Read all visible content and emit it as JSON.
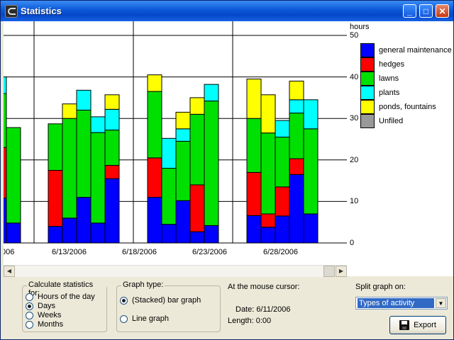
{
  "window": {
    "title": "Statistics"
  },
  "titlebar": {
    "minimize": "_",
    "maximize": "□",
    "close": "✕"
  },
  "axis": {
    "unit": "hours",
    "ticks": [
      "50",
      "40",
      "30",
      "20",
      "10",
      "0"
    ]
  },
  "legend": [
    {
      "label": "general maintenance",
      "color": "#0000ff"
    },
    {
      "label": "hedges",
      "color": "#ff0000"
    },
    {
      "label": "lawns",
      "color": "#00e000"
    },
    {
      "label": "plants",
      "color": "#00ffff"
    },
    {
      "label": "ponds, fountains",
      "color": "#ffff00"
    },
    {
      "label": "Unfiled",
      "color": "#999999"
    }
  ],
  "chart_data": {
    "type": "bar",
    "stacked": true,
    "ylabel": "hours",
    "ylim": [
      0,
      50
    ],
    "x_ticks": [
      "006",
      "6/13/2006",
      "6/18/2006",
      "6/23/2006",
      "6/28/2006"
    ],
    "series_names": [
      "general maintenance",
      "hedges",
      "lawns",
      "plants",
      "ponds, fountains",
      "Unfiled"
    ],
    "bars": [
      {
        "segments": [
          10.8,
          12.2,
          13.0,
          4.0,
          0,
          0
        ],
        "partial": true
      },
      {
        "segments": [
          4.8,
          0,
          23.0,
          0,
          0,
          0
        ]
      },
      {
        "segments": [
          4.0,
          13.5,
          11.2,
          0,
          0,
          0
        ]
      },
      {
        "segments": [
          6.0,
          0,
          24.0,
          0,
          3.5,
          0
        ]
      },
      {
        "segments": [
          11.0,
          0,
          21.0,
          4.8,
          0,
          0
        ]
      },
      {
        "segments": [
          4.8,
          0,
          21.8,
          3.8,
          0,
          0
        ]
      },
      {
        "segments": [
          15.5,
          3.2,
          8.5,
          5.0,
          3.5,
          0
        ]
      },
      {
        "segments": [
          11.0,
          9.5,
          16.0,
          0,
          4.0,
          0
        ]
      },
      {
        "segments": [
          4.5,
          0,
          13.5,
          7.2,
          0,
          0
        ]
      },
      {
        "segments": [
          10.2,
          0,
          14.3,
          3.0,
          4.0,
          0
        ]
      },
      {
        "segments": [
          2.7,
          11.3,
          17.0,
          0,
          4.0,
          0
        ]
      },
      {
        "segments": [
          4.2,
          0,
          30.0,
          4.0,
          0,
          0
        ]
      },
      {
        "segments": [
          6.6,
          10.4,
          13.0,
          0,
          9.5,
          0
        ]
      },
      {
        "segments": [
          3.8,
          3.2,
          19.5,
          0,
          9.2,
          0
        ]
      },
      {
        "segments": [
          6.5,
          7.0,
          12.0,
          4.0,
          0,
          0
        ]
      },
      {
        "segments": [
          16.5,
          3.8,
          11.0,
          3.2,
          4.5,
          0
        ]
      },
      {
        "segments": [
          7.0,
          0,
          20.5,
          7.0,
          0,
          0
        ]
      }
    ]
  },
  "calc": {
    "title": "Calculate statistics for:",
    "options": [
      "Hours of the day",
      "Days",
      "Weeks",
      "Months"
    ],
    "selected": 1
  },
  "graph_type": {
    "title": "Graph type:",
    "options": [
      "(Stacked) bar graph",
      "Line graph"
    ],
    "selected": 0
  },
  "cursor_info": {
    "title": "At the mouse cursor:",
    "date": "Date: 6/11/2006",
    "length": "Length: 0:00"
  },
  "split": {
    "label": "Split graph on:",
    "value": "Types of activity"
  },
  "export": {
    "label": "Export"
  },
  "scroll": {
    "left": "◀",
    "right": "▶"
  }
}
